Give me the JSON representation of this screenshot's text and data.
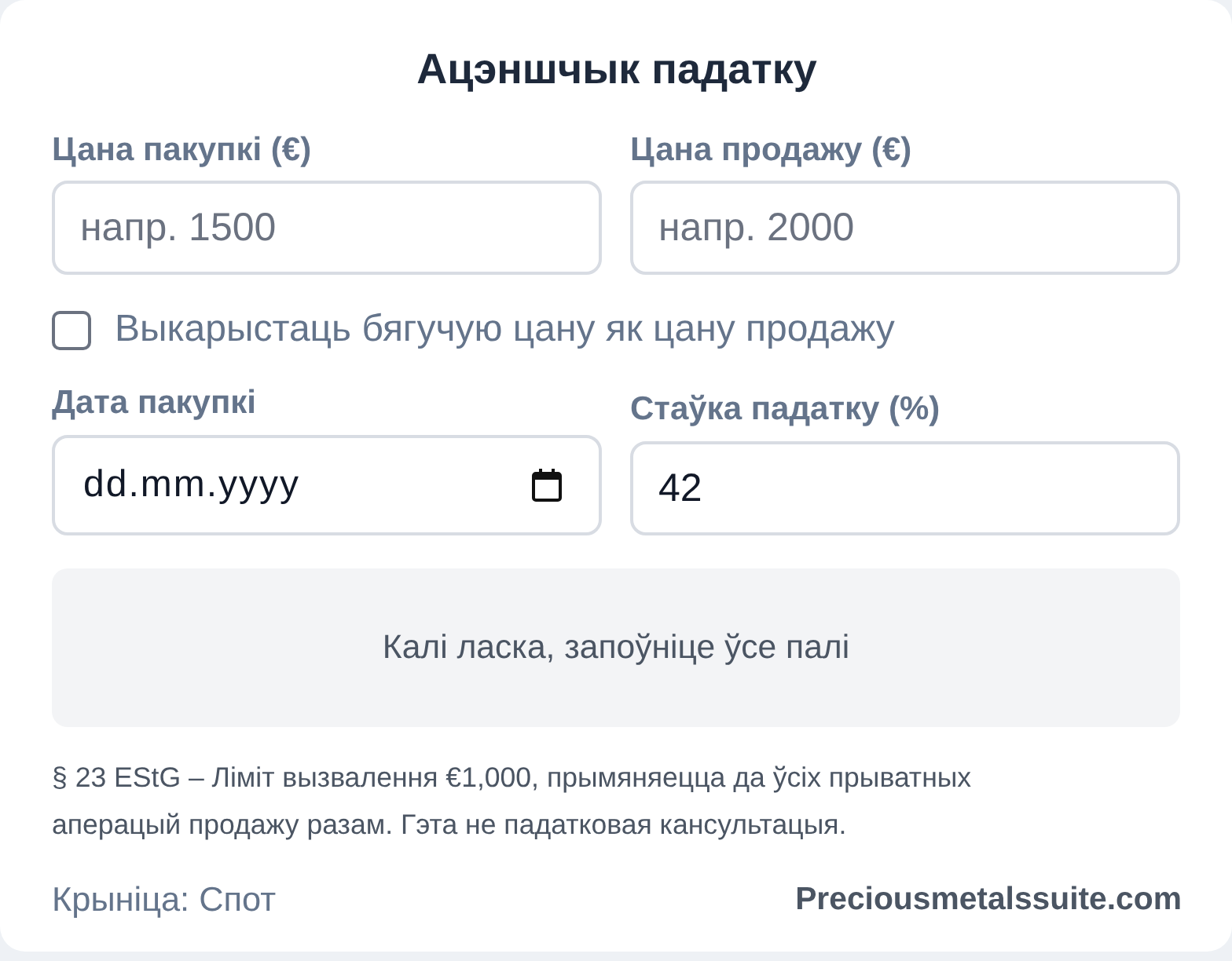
{
  "title": "Ацэншчык падатку",
  "price_fields": [
    {
      "label": "Цана пакупкі (€)",
      "kind": "number",
      "placeholder": "напр. 1500"
    },
    {
      "label": "Цана продажу (€)",
      "kind": "number",
      "placeholder": "напр. 2000"
    }
  ],
  "spot_option": {
    "label": "Выкарыстаць бягучую цану як цану продажу",
    "checked": false
  },
  "detail_fields": [
    {
      "label": "Дата пакупкі",
      "kind": "date",
      "placeholder": "dd.mm.yyyy"
    },
    {
      "label": "Стаўка падатку (%)",
      "kind": "number",
      "value": "42"
    }
  ],
  "result": {
    "message": "Калі ласка, запоўніце ўсе палі"
  },
  "disclaimer": "§ 23 EStG – Ліміт вызвалення €1,000, прымяняецца да ўсіх прыватных аперацый продажу разам. Гэта не падатковая кансультацыя.",
  "footer": {
    "source": "Крыніца: Спот",
    "brand": "Preciousmetalssuite.com"
  }
}
